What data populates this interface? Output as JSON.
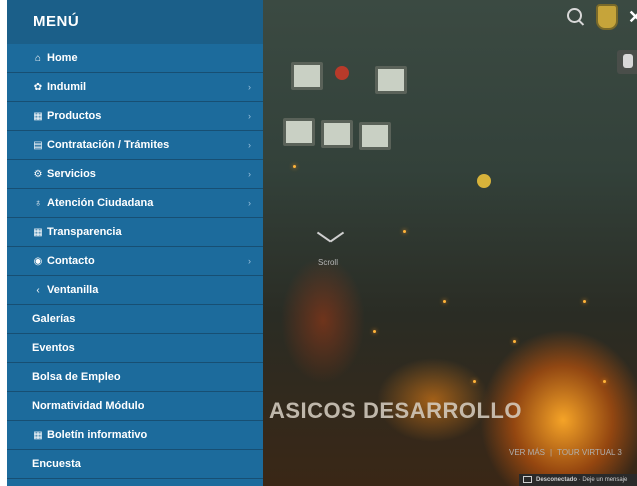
{
  "menu": {
    "title": "MENÚ",
    "items": [
      {
        "label": "Home",
        "icon": "home-icon",
        "glyph": "⌂",
        "submenu": false
      },
      {
        "label": "Indumil",
        "icon": "gear-icon",
        "glyph": "✿",
        "submenu": true
      },
      {
        "label": "Productos",
        "icon": "document-icon",
        "glyph": "▦",
        "submenu": true
      },
      {
        "label": "Contratación / Trámites",
        "icon": "form-icon",
        "glyph": "▤",
        "submenu": true
      },
      {
        "label": "Servicios",
        "icon": "services-icon",
        "glyph": "⚙",
        "submenu": true
      },
      {
        "label": "Atención Ciudadana",
        "icon": "location-icon",
        "glyph": "♁",
        "submenu": true
      },
      {
        "label": "Transparencia",
        "icon": "transparency-icon",
        "glyph": "▦",
        "submenu": false
      },
      {
        "label": "Contacto",
        "icon": "contact-icon",
        "glyph": "◉",
        "submenu": true
      },
      {
        "label": "Ventanilla",
        "icon": "back-chevron-icon",
        "glyph": "‹",
        "submenu": false
      },
      {
        "label": "Galerías",
        "icon": "",
        "glyph": "",
        "submenu": false
      },
      {
        "label": "Eventos",
        "icon": "",
        "glyph": "",
        "submenu": false
      },
      {
        "label": "Bolsa de Empleo",
        "icon": "",
        "glyph": "",
        "submenu": false
      },
      {
        "label": "Normatividad Módulo",
        "icon": "",
        "glyph": "",
        "submenu": false
      },
      {
        "label": "Boletín informativo",
        "icon": "newsletter-icon",
        "glyph": "▦",
        "submenu": false
      },
      {
        "label": "Encuesta",
        "icon": "",
        "glyph": "",
        "submenu": false
      }
    ]
  },
  "hero": {
    "scroll_label": "Scroll",
    "headline": "ASICOS DESARROLLO",
    "links": [
      "VER MÁS",
      "TOUR VIRTUAL 3"
    ],
    "link_separator": "|",
    "close_glyph": "✕"
  },
  "status_bar": {
    "status": "Desconectado",
    "message": "· Deje un mensaje"
  },
  "colors": {
    "menu_bg": "#1c6b9c",
    "menu_header_bg": "#1b5f89",
    "menu_divider": "#174f73"
  }
}
